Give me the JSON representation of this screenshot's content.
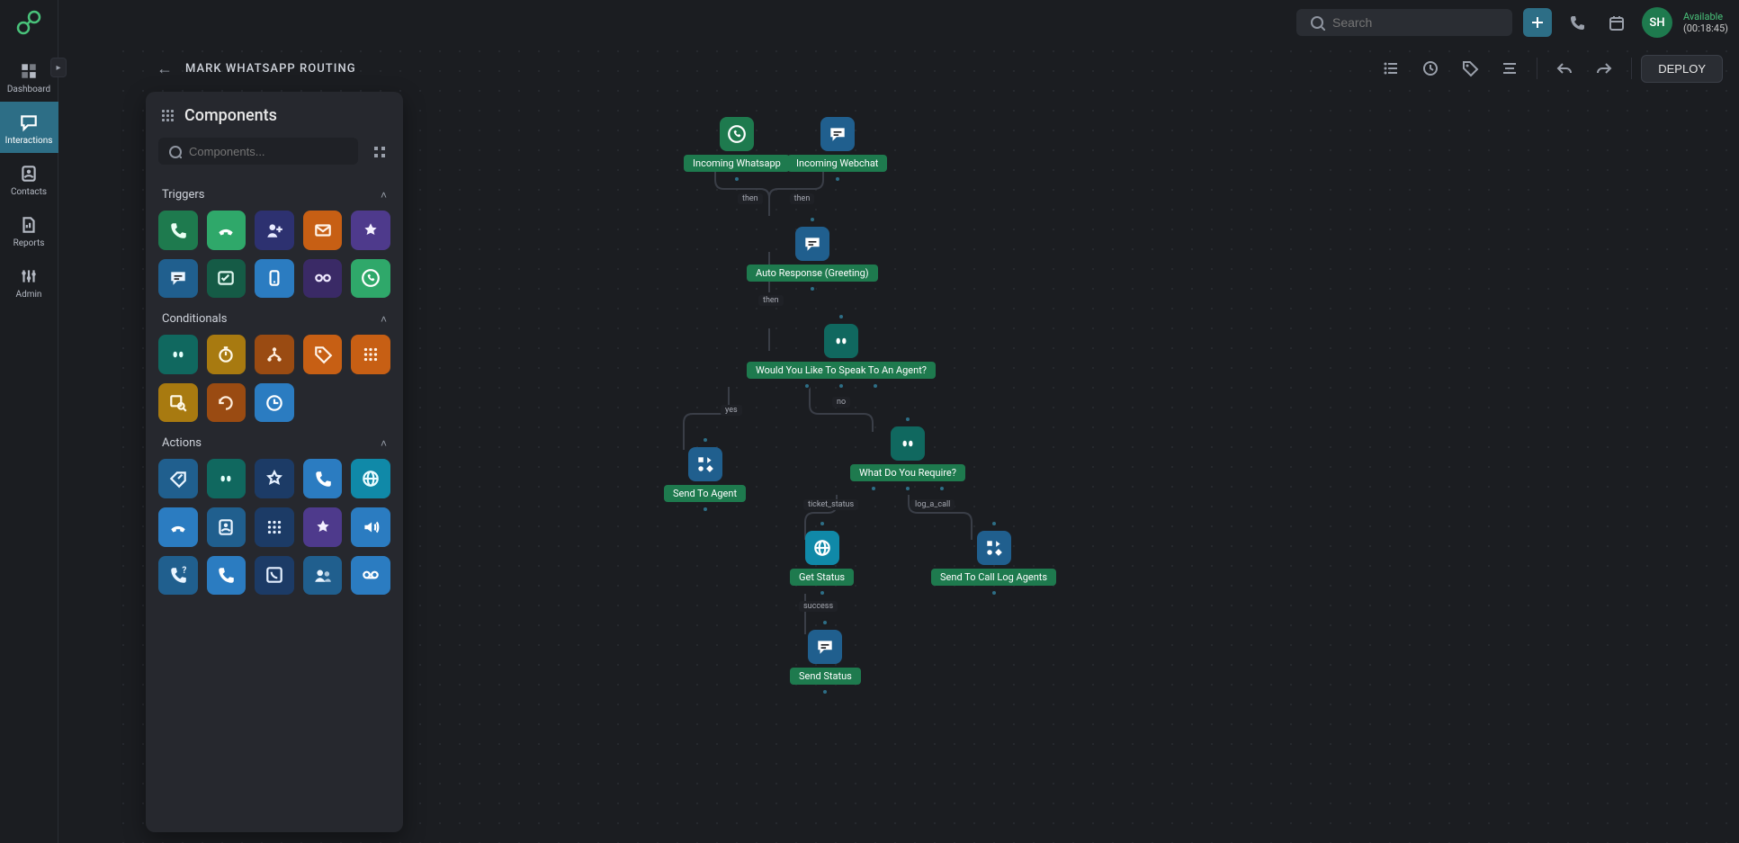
{
  "topbar": {
    "search_placeholder": "Search",
    "avatar_initials": "SH",
    "presence_status": "Available",
    "presence_timer": "(00:18:45)"
  },
  "mainnav": {
    "items": [
      {
        "label": "Dashboard"
      },
      {
        "label": "Interactions"
      },
      {
        "label": "Contacts"
      },
      {
        "label": "Reports"
      },
      {
        "label": "Admin"
      }
    ]
  },
  "flow": {
    "title": "MARK WHATSAPP ROUTING",
    "deploy_label": "DEPLOY"
  },
  "panel": {
    "title": "Components",
    "search_placeholder": "Components...",
    "sections": {
      "triggers": "Triggers",
      "conditionals": "Conditionals",
      "actions": "Actions"
    }
  },
  "nodes": {
    "incoming_whatsapp": "Incoming Whatsapp",
    "incoming_webchat": "Incoming Webchat",
    "auto_response": "Auto Response (Greeting)",
    "would_you_like": "Would You Like To Speak To An Agent?",
    "what_do_you_require": "What Do You Require?",
    "send_to_agent": "Send To Agent",
    "send_to_call_log": "Send To Call Log Agents",
    "get_status": "Get Status",
    "send_status": "Send Status"
  },
  "edges": {
    "then1": "then",
    "then2": "then",
    "then3": "then",
    "yes": "yes",
    "no": "no",
    "ticket_status": "ticket_status",
    "log_a_call": "log_a_call",
    "success": "success"
  },
  "icons": {
    "phone_in": "phone-in",
    "phone_out": "phone-out",
    "add_user": "add-user",
    "mail": "mail",
    "badge": "badge",
    "chat": "chat",
    "task": "task",
    "mobile": "mobile",
    "api": "api",
    "whatsapp": "whatsapp",
    "branch": "branch",
    "timer": "timer",
    "tag": "tag",
    "grid": "grid",
    "lookup": "lookup",
    "retry": "retry",
    "clock": "clock",
    "tag_out": "tag-out",
    "branch2": "branch",
    "star": "star",
    "call": "call",
    "globe": "globe",
    "hangup": "hangup",
    "contact": "contact",
    "dialpad": "dialpad",
    "badge2": "badge",
    "speaker": "speaker",
    "call_q": "call-q",
    "phone2": "phone",
    "voicebox": "voicebox",
    "group": "group",
    "voicemail": "voicemail"
  }
}
